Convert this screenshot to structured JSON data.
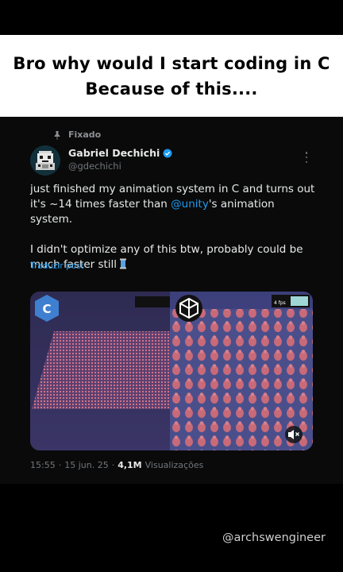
{
  "caption": {
    "line1": "Bro why would I start coding in C",
    "line2": "Because of this...."
  },
  "tweet": {
    "pinned_label": "Fixado",
    "author_name": "Gabriel Dechichi",
    "author_handle": "@gdechichi",
    "text_part1": "just finished my animation system in C and turns out it's ~14 times faster than ",
    "mention": "@unity",
    "text_part2": "'s animation system.",
    "text_para2": "I didn't optimize any of this btw, probably could be much faster still",
    "translate_label": "Traduzir post",
    "media": {
      "left_logo": "C",
      "right_fps": "4 fps",
      "mute_icon": "volume-off-icon"
    },
    "time": "15:55",
    "date": "15 jun. 25",
    "views_count": "4,1M",
    "views_label": "Visualizações"
  },
  "watermark": "@archswengineer",
  "colors": {
    "accent": "#1d9bf0",
    "background": "#000000",
    "caption_bg": "#ffffff"
  }
}
